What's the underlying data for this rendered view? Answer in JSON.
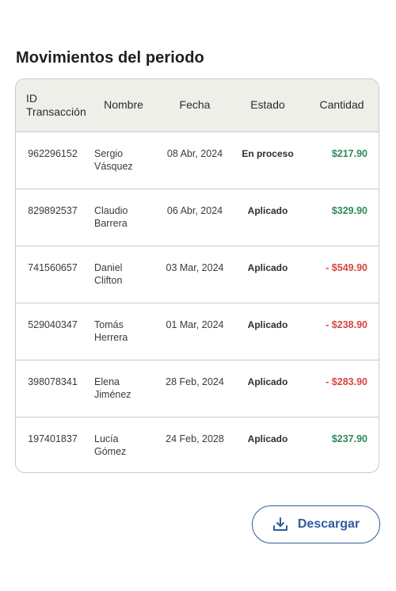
{
  "page": {
    "title": "Movimientos del periodo"
  },
  "table": {
    "headers": {
      "id": "ID Transacción",
      "name": "Nombre",
      "date": "Fecha",
      "status": "Estado",
      "amount": "Cantidad"
    },
    "rows": [
      {
        "id": "962296152",
        "name": "Sergio Vásquez",
        "date": "08 Abr, 2024",
        "status": "En proceso",
        "amount": "$217.90",
        "sign": "positive"
      },
      {
        "id": "829892537",
        "name": "Claudio Barrera",
        "date": "06 Abr, 2024",
        "status": "Aplicado",
        "amount": "$329.90",
        "sign": "positive"
      },
      {
        "id": "741560657",
        "name": "Daniel Clifton",
        "date": "03 Mar, 2024",
        "status": "Aplicado",
        "amount": "- $549.90",
        "sign": "negative"
      },
      {
        "id": "529040347",
        "name": "Tomás Herrera",
        "date": "01 Mar, 2024",
        "status": "Aplicado",
        "amount": "- $238.90",
        "sign": "negative"
      },
      {
        "id": "398078341",
        "name": "Elena Jiménez",
        "date": "28 Feb, 2024",
        "status": "Aplicado",
        "amount": "- $283.90",
        "sign": "negative"
      },
      {
        "id": "197401837",
        "name": "Lucía Gómez",
        "date": "24 Feb, 2028",
        "status": "Aplicado",
        "amount": "$237.90",
        "sign": "positive"
      }
    ]
  },
  "actions": {
    "download_label": "Descargar",
    "download_icon": "download-icon"
  },
  "colors": {
    "positive": "#2e8a5a",
    "negative": "#d9443e",
    "accent": "#2f5c9e",
    "header_bg": "#efefea"
  }
}
